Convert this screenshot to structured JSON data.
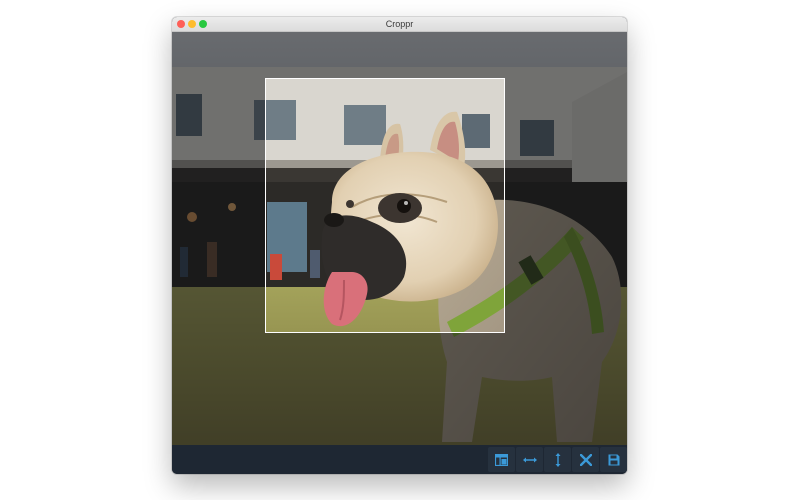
{
  "window": {
    "title": "Croppr"
  },
  "colors": {
    "accent": "#3b9ad9",
    "toolbar_bg": "#1e2733",
    "button_bg": "#26313e"
  },
  "toolbar": {
    "buttons": [
      {
        "name": "layout-button",
        "icon": "layout-icon"
      },
      {
        "name": "flip-horizontal-button",
        "icon": "horizontal-arrows-icon"
      },
      {
        "name": "flip-vertical-button",
        "icon": "vertical-arrows-icon"
      },
      {
        "name": "close-button",
        "icon": "close-icon"
      },
      {
        "name": "save-button",
        "icon": "save-icon"
      }
    ]
  }
}
